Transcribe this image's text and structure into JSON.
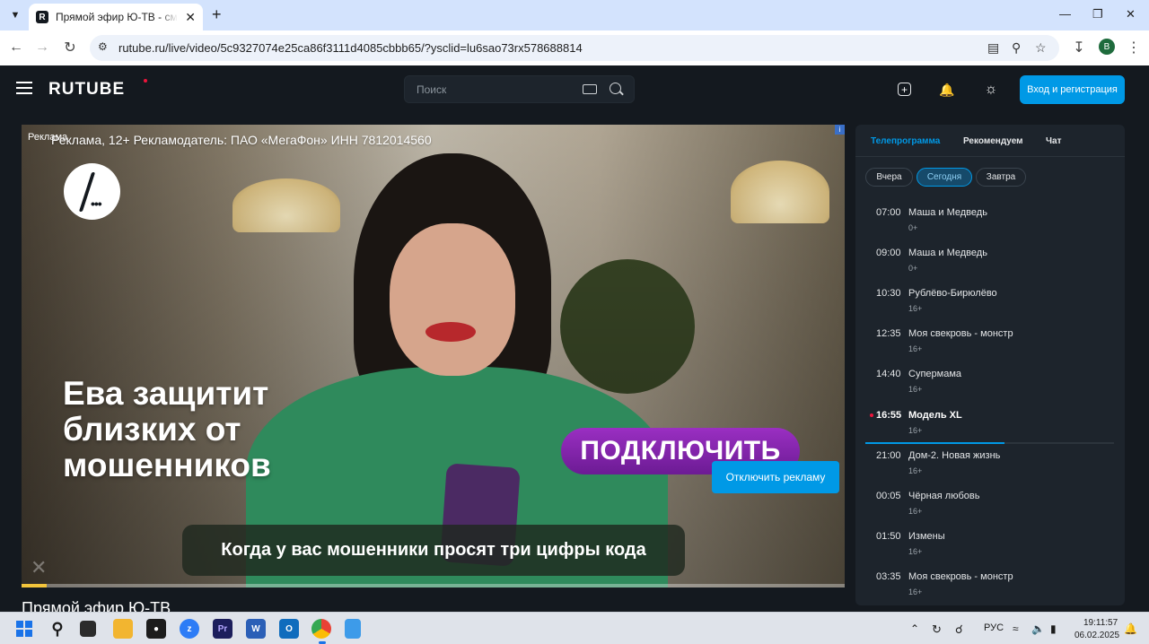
{
  "browser": {
    "tab_title": "Прямой эфир Ю-ТВ - смотреть онлайн",
    "tab_close": "✕",
    "new_tab": "+",
    "url": "rutube.ru/live/video/5c9327074e25ca86f3111d4085cbbb65/?ysclid=lu6sao73rx578688814",
    "profile_initial": "B",
    "window_controls": {
      "minimize": "—",
      "maximize": "❐",
      "close": "✕"
    }
  },
  "site": {
    "logo": "RUTUBE",
    "search_placeholder": "Поиск",
    "login_button": "Вход и регистрация",
    "accent_color": "#0099e6"
  },
  "player": {
    "ad_label": "Реклама",
    "ad_info": "Реклама, 12+ Рекламодатель: ПАО «МегаФон» ИНН 7812014560",
    "slogan": "Ева защитит близких от мошенников",
    "connect_text": "ПОДКЛЮЧИТЬ",
    "skip_ad_button": "Отключить рекламу",
    "subtitle": "Когда у вас мошенники просят три цифры кода",
    "progress_fraction": 0.03,
    "info_badge": "i"
  },
  "video_title": "Прямой эфир Ю-ТВ",
  "guide": {
    "tabs": [
      "Телепрограмма",
      "Рекомендуем",
      "Чат"
    ],
    "days": [
      "Вчера",
      "Сегодня",
      "Завтра"
    ],
    "programs": [
      {
        "time": "07:00",
        "title": "Маша и Медведь",
        "age": "0+"
      },
      {
        "time": "09:00",
        "title": "Маша и Медведь",
        "age": "0+"
      },
      {
        "time": "10:30",
        "title": "Рублёво-Бирюлёво",
        "age": "16+"
      },
      {
        "time": "12:35",
        "title": "Моя свекровь - монстр",
        "age": "16+"
      },
      {
        "time": "14:40",
        "title": "Супермама",
        "age": "16+"
      },
      {
        "time": "16:55",
        "title": "Модель XL",
        "age": "16+"
      },
      {
        "time": "21:00",
        "title": "Дом-2. Новая жизнь",
        "age": "16+"
      },
      {
        "time": "00:05",
        "title": "Чёрная любовь",
        "age": "16+"
      },
      {
        "time": "01:50",
        "title": "Измены",
        "age": "16+"
      },
      {
        "time": "03:35",
        "title": "Моя свекровь - монстр",
        "age": "16+"
      }
    ],
    "live_progress_fraction": 0.56
  },
  "taskbar": {
    "language": "РУС",
    "time": "19:11:57",
    "date": "06.02.2025"
  }
}
